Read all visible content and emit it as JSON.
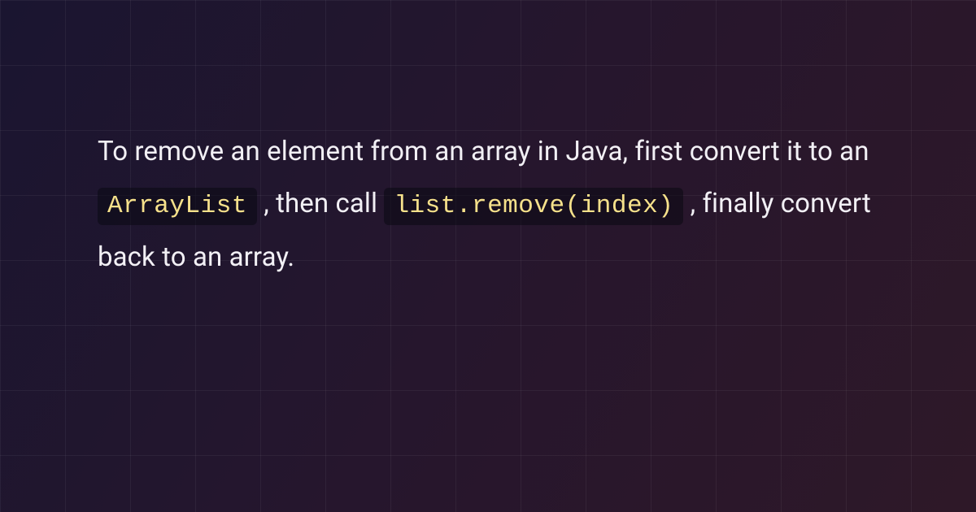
{
  "text": {
    "part1": "To remove an element from an array in Java, first convert it to an ",
    "code1": "ArrayList",
    "part2": ", then call ",
    "code2": "list.remove(index)",
    "part3": ", finally convert back to an array."
  }
}
